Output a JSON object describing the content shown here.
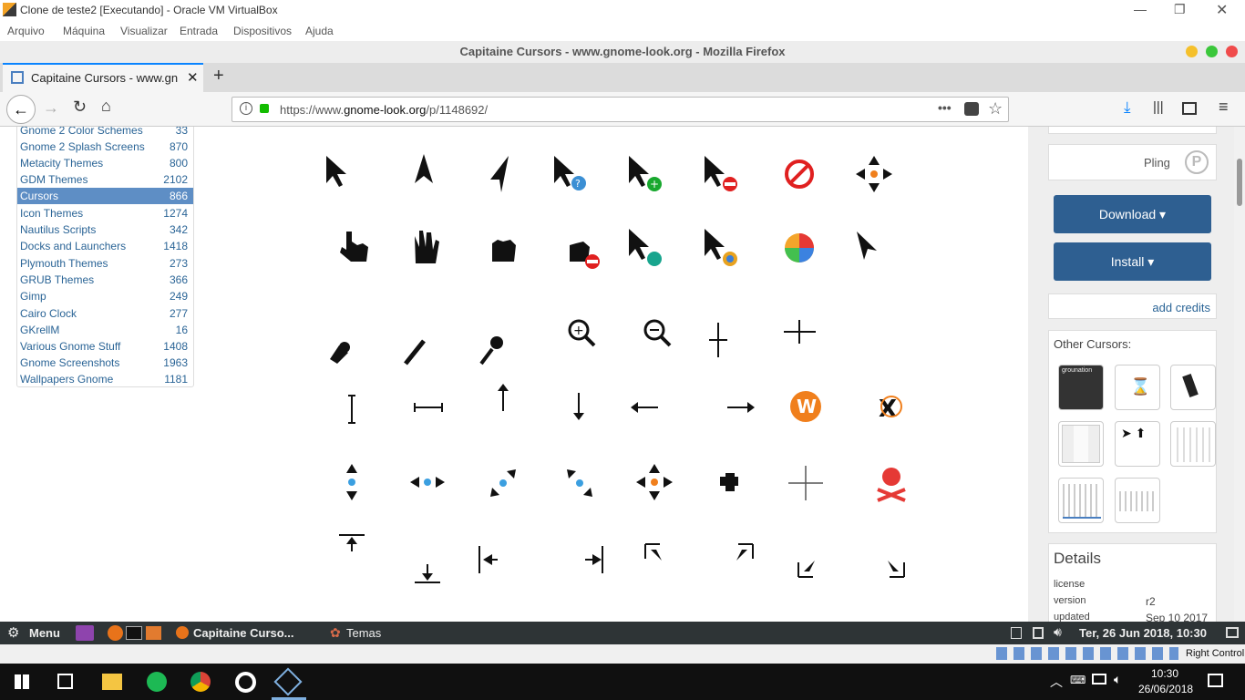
{
  "vbox": {
    "title": "Clone de teste2 [Executando] - Oracle VM VirtualBox",
    "menu": [
      "Arquivo",
      "Máquina",
      "Visualizar",
      "Entrada",
      "Dispositivos",
      "Ajuda"
    ]
  },
  "firefox": {
    "window_title": "Capitaine Cursors - www.gnome-look.org - Mozilla Firefox",
    "tab_label": "Capitaine Cursors - www.gn",
    "url_prefix": "https://www.",
    "url_domain": "gnome-look.org",
    "url_path": "/p/1148692/"
  },
  "categories": [
    {
      "name": "Gnome 2 Color Schemes",
      "count": "33"
    },
    {
      "name": "Gnome 2 Splash Screens",
      "count": "870"
    },
    {
      "name": "Metacity Themes",
      "count": "800"
    },
    {
      "name": "GDM Themes",
      "count": "2102"
    },
    {
      "name": "Cursors",
      "count": "866",
      "selected": true
    },
    {
      "name": "Icon Themes",
      "count": "1274"
    },
    {
      "name": "Nautilus Scripts",
      "count": "342"
    },
    {
      "name": "Docks and Launchers",
      "count": "1418"
    },
    {
      "name": "Plymouth Themes",
      "count": "273"
    },
    {
      "name": "GRUB Themes",
      "count": "366"
    },
    {
      "name": "Gimp",
      "count": "249"
    },
    {
      "name": "Cairo Clock",
      "count": "277"
    },
    {
      "name": "GKrellM",
      "count": "16"
    },
    {
      "name": "Various Gnome Stuff",
      "count": "1408"
    },
    {
      "name": "Gnome Screenshots",
      "count": "1963"
    },
    {
      "name": "Wallpapers Gnome",
      "count": "1181"
    }
  ],
  "sidebar": {
    "pling_label": "Pling",
    "download_label": "Download ▾",
    "install_label": "Install ▾",
    "add_credits": "add credits",
    "other_cursors_title": "Other Cursors:",
    "thumb_text": "grounation",
    "details_title": "Details",
    "details": [
      {
        "key": "license",
        "value": ""
      },
      {
        "key": "version",
        "value": "r2"
      },
      {
        "key": "updated",
        "value": "Sep 10 2017"
      }
    ]
  },
  "taskbar": {
    "menu_label": "Menu",
    "firefox_task": "Capitaine Curso...",
    "temas_task": "Temas",
    "datetime": "Ter, 26 Jun 2018, 10:30"
  },
  "vbox_status": {
    "host_key": "Right Control"
  },
  "windows": {
    "time": "10:30",
    "date": "26/06/2018"
  }
}
